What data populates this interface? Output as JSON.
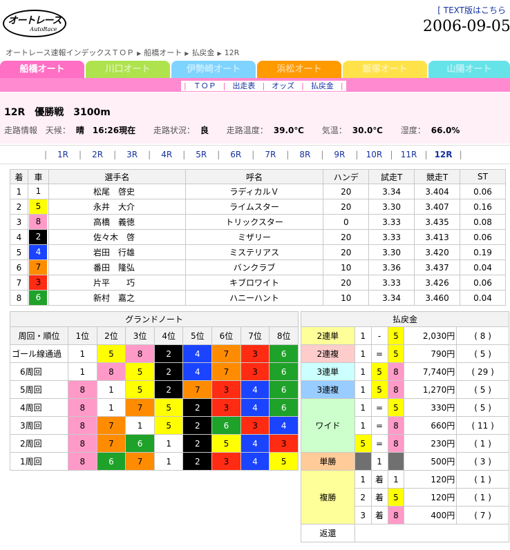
{
  "header": {
    "logo_text": "オートレース",
    "logo_sub": "AutoRace",
    "text_link": "TEXT版はこちら",
    "date": "2006-09-05"
  },
  "breadcrumb": [
    "オートレース速報インデックスＴＯＰ",
    "船橋オート",
    "払戻金",
    "12R"
  ],
  "tabs": [
    {
      "label": "船橋オート",
      "color": "#ff6fc4",
      "active": true
    },
    {
      "label": "川口オート",
      "color": "#aee34e",
      "active": false
    },
    {
      "label": "伊勢崎オート",
      "color": "#7fd4ff",
      "active": false
    },
    {
      "label": "浜松オート",
      "color": "#ff9a00",
      "active": false
    },
    {
      "label": "飯塚オート",
      "color": "#ffe24a",
      "active": false
    },
    {
      "label": "山陽オート",
      "color": "#66e3e8",
      "active": false
    }
  ],
  "subnav": [
    "ＴＯＰ",
    "出走表",
    "オッズ",
    "払戻金"
  ],
  "race": {
    "number": "12R",
    "name": "優勝戦",
    "distance": "3100m",
    "info_label": "走路情報",
    "weather_label": "天候：",
    "weather": "晴",
    "time": "16:26現在",
    "track_label": "走路状況：",
    "track": "良",
    "track_temp_label": "走路温度：",
    "track_temp": "39.0℃",
    "air_temp_label": "気温：",
    "air_temp": "30.0℃",
    "humidity_label": "湿度：",
    "humidity": "66.0%"
  },
  "race_nav": [
    "1R",
    "2R",
    "3R",
    "4R",
    "5R",
    "6R",
    "7R",
    "8R",
    "9R",
    "10R",
    "11R",
    "12R"
  ],
  "car_colors": {
    "1": {
      "bg": "#ffffff",
      "fg": "#000000"
    },
    "2": {
      "bg": "#000000",
      "fg": "#ffffff"
    },
    "3": {
      "bg": "#ff2b12",
      "fg": "#000000"
    },
    "4": {
      "bg": "#1a44ff",
      "fg": "#ffffff"
    },
    "5": {
      "bg": "#ffff00",
      "fg": "#000000"
    },
    "6": {
      "bg": "#1fa22a",
      "fg": "#ffffff"
    },
    "7": {
      "bg": "#ff8c00",
      "fg": "#000000"
    },
    "8": {
      "bg": "#ff9ac8",
      "fg": "#000000"
    }
  },
  "entries": {
    "headers": [
      "着",
      "車",
      "選手名",
      "呼名",
      "ハンデ",
      "試走T",
      "競走T",
      "ST"
    ],
    "rows": [
      [
        "1",
        "1",
        "松尾　啓史",
        "ラディカルＶ",
        "20",
        "3.34",
        "3.404",
        "0.06"
      ],
      [
        "2",
        "5",
        "永井　大介",
        "ライムスター",
        "20",
        "3.30",
        "3.407",
        "0.16"
      ],
      [
        "3",
        "8",
        "高橋　義徳",
        "トリックスター",
        "0",
        "3.33",
        "3.435",
        "0.08"
      ],
      [
        "4",
        "2",
        "佐々木　啓",
        "ミザリー",
        "20",
        "3.33",
        "3.413",
        "0.06"
      ],
      [
        "5",
        "4",
        "岩田　行雄",
        "ミステリアス",
        "20",
        "3.30",
        "3.420",
        "0.19"
      ],
      [
        "6",
        "7",
        "番田　隆弘",
        "バンクラブ",
        "10",
        "3.36",
        "3.437",
        "0.04"
      ],
      [
        "7",
        "3",
        "片平　　巧",
        "キブロワイト",
        "20",
        "3.33",
        "3.426",
        "0.06"
      ],
      [
        "8",
        "6",
        "新村　嘉之",
        "ハニーハント",
        "10",
        "3.34",
        "3.460",
        "0.04"
      ]
    ]
  },
  "grand_note": {
    "title": "グランドノート",
    "headers": [
      "周回・順位",
      "1位",
      "2位",
      "3位",
      "4位",
      "5位",
      "6位",
      "7位",
      "8位"
    ],
    "rows": [
      {
        "label": "ゴール線通過",
        "cars": [
          "1",
          "5",
          "8",
          "2",
          "4",
          "7",
          "3",
          "6"
        ]
      },
      {
        "label": "6周回",
        "cars": [
          "1",
          "8",
          "5",
          "2",
          "4",
          "7",
          "3",
          "6"
        ]
      },
      {
        "label": "5周回",
        "cars": [
          "8",
          "1",
          "5",
          "2",
          "7",
          "3",
          "4",
          "6"
        ]
      },
      {
        "label": "4周回",
        "cars": [
          "8",
          "1",
          "7",
          "5",
          "2",
          "3",
          "4",
          "6"
        ]
      },
      {
        "label": "3周回",
        "cars": [
          "8",
          "7",
          "1",
          "5",
          "2",
          "6",
          "3",
          "4"
        ]
      },
      {
        "label": "2周回",
        "cars": [
          "8",
          "7",
          "6",
          "1",
          "2",
          "5",
          "4",
          "3"
        ]
      },
      {
        "label": "1周回",
        "cars": [
          "8",
          "6",
          "7",
          "1",
          "2",
          "3",
          "4",
          "5"
        ]
      }
    ]
  },
  "payout": {
    "title": "払戻金",
    "rows": [
      {
        "type": "2連単",
        "bg": "#ffff99",
        "combo": [
          "1",
          "-",
          "5"
        ],
        "amount": "2,030円",
        "pop": "( 8 )"
      },
      {
        "type": "2連複",
        "bg": "#ffcccc",
        "combo": [
          "1",
          "=",
          "5"
        ],
        "amount": "790円",
        "pop": "( 5 )"
      },
      {
        "type": "3連単",
        "bg": "#ccffff",
        "combo": [
          "1",
          "5",
          "8"
        ],
        "amount": "7,740円",
        "pop": "( 29 )"
      },
      {
        "type": "3連複",
        "bg": "#99ccff",
        "combo": [
          "1",
          "5",
          "8"
        ],
        "amount": "1,270円",
        "pop": "( 5 )"
      },
      {
        "type": "ワイド",
        "bg": "#ccffcc",
        "combo": [
          "1",
          "=",
          "5"
        ],
        "amount": "330円",
        "pop": "( 5 )"
      },
      {
        "type": "",
        "bg": "#ccffcc",
        "combo": [
          "1",
          "=",
          "8"
        ],
        "amount": "660円",
        "pop": "( 11 )"
      },
      {
        "type": "",
        "bg": "#ccffcc",
        "combo": [
          "5",
          "=",
          "8"
        ],
        "amount": "230円",
        "pop": "( 1 )"
      },
      {
        "type": "単勝",
        "bg": "#ffcc99",
        "combo": [
          "",
          "1",
          ""
        ],
        "amount": "500円",
        "pop": "( 3 )"
      },
      {
        "type": "複勝",
        "bg": "#ffff99",
        "combo": [
          "1",
          "着",
          "1"
        ],
        "amount": "120円",
        "pop": "( 1 )"
      },
      {
        "type": "",
        "bg": "#ffff99",
        "combo": [
          "2",
          "着",
          "5"
        ],
        "amount": "120円",
        "pop": "( 1 )"
      },
      {
        "type": "",
        "bg": "#ffff99",
        "combo": [
          "3",
          "着",
          "8"
        ],
        "amount": "400円",
        "pop": "( 7 )"
      },
      {
        "type": "返還",
        "bg": "#ffffff",
        "combo": [
          "",
          "",
          ""
        ],
        "amount": "",
        "pop": ""
      }
    ]
  }
}
